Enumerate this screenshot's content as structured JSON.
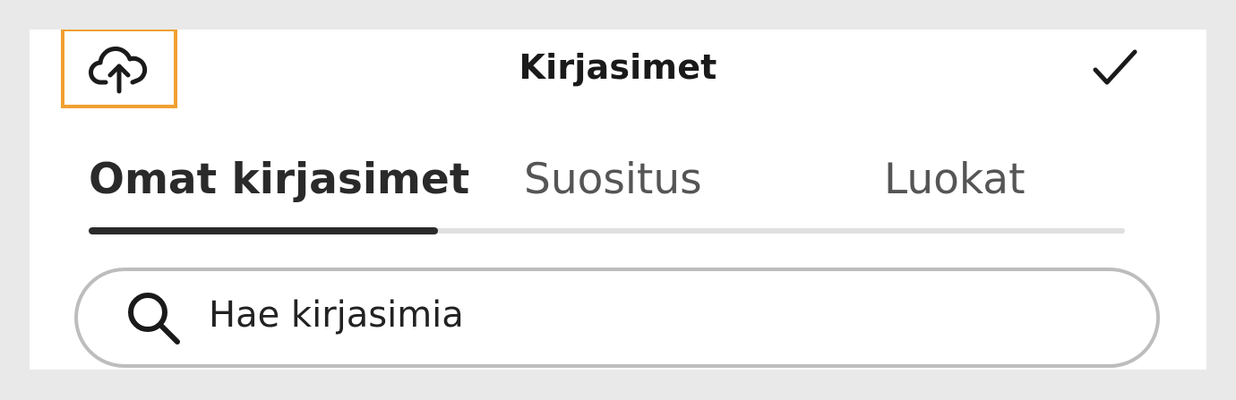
{
  "header": {
    "title": "Kirjasimet",
    "upload_icon": "cloud-upload-icon",
    "done_icon": "checkmark-icon",
    "highlight_color": "#f0a030"
  },
  "tabs": [
    {
      "label": "Omat kirjasimet",
      "active": true
    },
    {
      "label": "Suositus",
      "active": false
    },
    {
      "label": "Luokat",
      "active": false
    }
  ],
  "search": {
    "placeholder": "Hae kirjasimia",
    "icon": "search-icon"
  }
}
